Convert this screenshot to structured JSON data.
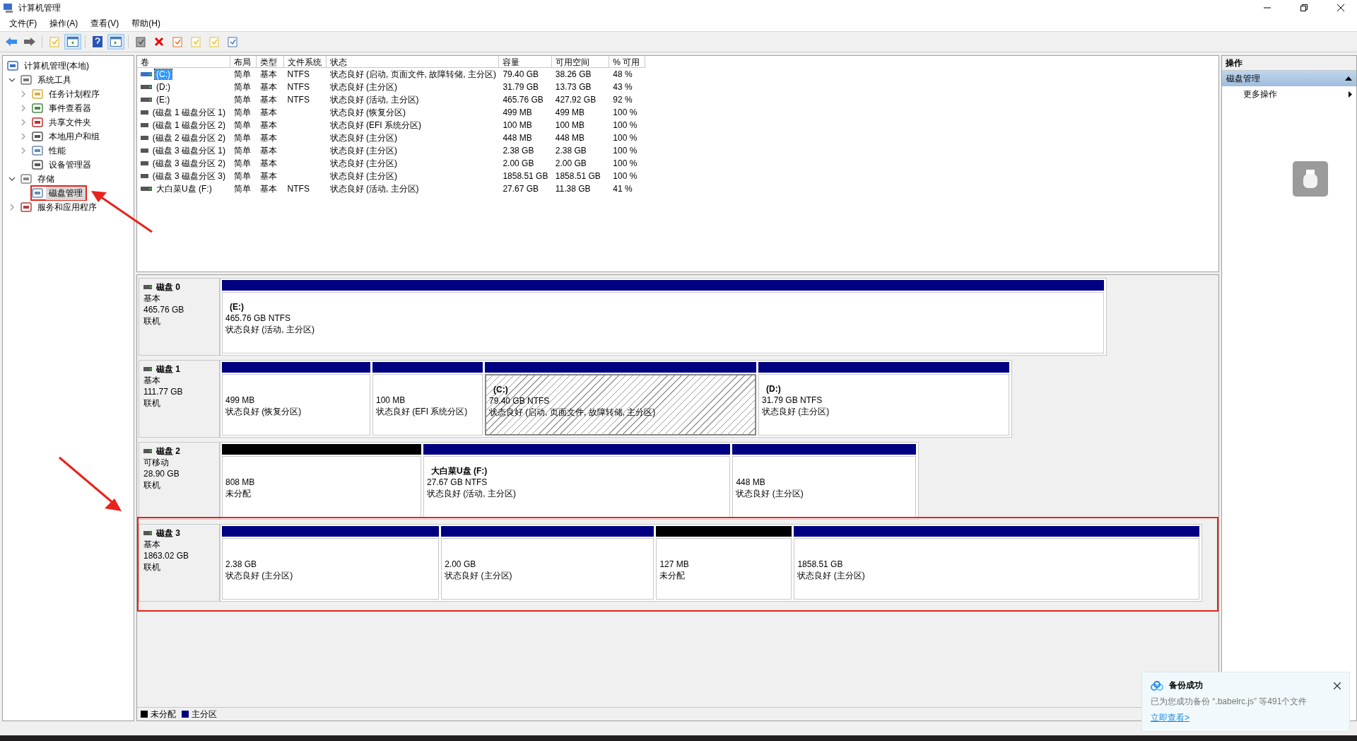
{
  "window": {
    "title": "计算机管理"
  },
  "menu": [
    "文件(F)",
    "操作(A)",
    "查看(V)",
    "帮助(H)"
  ],
  "toolbar": [
    {
      "pressed": false
    },
    {
      "pressed": false
    },
    {
      "pressed": false
    },
    {
      "pressed": true
    },
    {
      "pressed": false
    },
    {
      "pressed": true
    },
    {
      "pressed": false
    },
    {
      "pressed": false
    },
    {
      "pressed": false
    },
    {
      "pressed": false
    },
    {
      "pressed": false
    },
    {
      "pressed": false
    }
  ],
  "tree": [
    {
      "label": "计算机管理(本地)",
      "selected": false,
      "highlighted": false,
      "children": [
        {
          "label": "系统工具",
          "expanded": true,
          "selected": false,
          "highlighted": false,
          "children": [
            {
              "label": "任务计划程序",
              "expanded": false,
              "selected": false,
              "highlighted": false
            },
            {
              "label": "事件查看器",
              "expanded": false,
              "selected": false,
              "highlighted": false
            },
            {
              "label": "共享文件夹",
              "expanded": false,
              "selected": false,
              "highlighted": false
            },
            {
              "label": "本地用户和组",
              "expanded": false,
              "selected": false,
              "highlighted": false
            },
            {
              "label": "性能",
              "expanded": false,
              "selected": false,
              "highlighted": false
            },
            {
              "label": "设备管理器",
              "selected": false,
              "highlighted": false
            }
          ]
        },
        {
          "label": "存储",
          "expanded": true,
          "selected": false,
          "highlighted": false,
          "children": [
            {
              "label": "磁盘管理",
              "selected": true,
              "highlighted": true
            }
          ]
        },
        {
          "label": "服务和应用程序",
          "expanded": false,
          "selected": false,
          "highlighted": false
        }
      ]
    }
  ],
  "table": {
    "columns": [
      "卷",
      "布局",
      "类型",
      "文件系统",
      "状态",
      "容量",
      "可用空间",
      "% 可用"
    ],
    "rows": [
      {
        "selected": true,
        "cells": [
          "(C:)",
          "简单",
          "基本",
          "NTFS",
          "状态良好 (启动, 页面文件, 故障转储, 主分区)",
          "79.40 GB",
          "38.26 GB",
          "48 %"
        ]
      },
      {
        "selected": false,
        "cells": [
          "(D:)",
          "简单",
          "基本",
          "NTFS",
          "状态良好 (主分区)",
          "31.79 GB",
          "13.73 GB",
          "43 %"
        ]
      },
      {
        "selected": false,
        "cells": [
          "(E:)",
          "简单",
          "基本",
          "NTFS",
          "状态良好 (活动, 主分区)",
          "465.76 GB",
          "427.92 GB",
          "92 %"
        ]
      },
      {
        "selected": false,
        "cells": [
          "(磁盘 1 磁盘分区 1)",
          "简单",
          "基本",
          "",
          "状态良好 (恢复分区)",
          "499 MB",
          "499 MB",
          "100 %"
        ]
      },
      {
        "selected": false,
        "cells": [
          "(磁盘 1 磁盘分区 2)",
          "简单",
          "基本",
          "",
          "状态良好 (EFI 系统分区)",
          "100 MB",
          "100 MB",
          "100 %"
        ]
      },
      {
        "selected": false,
        "cells": [
          "(磁盘 2 磁盘分区 2)",
          "简单",
          "基本",
          "",
          "状态良好 (主分区)",
          "448 MB",
          "448 MB",
          "100 %"
        ]
      },
      {
        "selected": false,
        "cells": [
          "(磁盘 3 磁盘分区 1)",
          "简单",
          "基本",
          "",
          "状态良好 (主分区)",
          "2.38 GB",
          "2.38 GB",
          "100 %"
        ]
      },
      {
        "selected": false,
        "cells": [
          "(磁盘 3 磁盘分区 2)",
          "简单",
          "基本",
          "",
          "状态良好 (主分区)",
          "2.00 GB",
          "2.00 GB",
          "100 %"
        ]
      },
      {
        "selected": false,
        "cells": [
          "(磁盘 3 磁盘分区 3)",
          "简单",
          "基本",
          "",
          "状态良好 (主分区)",
          "1858.51 GB",
          "1858.51 GB",
          "100 %"
        ]
      },
      {
        "selected": false,
        "cells": [
          "大白菜U盘 (F:)",
          "简单",
          "基本",
          "NTFS",
          "状态良好 (活动, 主分区)",
          "27.67 GB",
          "11.38 GB",
          "41 %"
        ]
      }
    ]
  },
  "disks": [
    {
      "name": "磁盘 0",
      "type": "基本",
      "size": "465.76 GB",
      "state": "联机",
      "highlighted": false,
      "partitions": [
        {
          "kind": "primary",
          "selected": false,
          "name": "(E:)",
          "size": "465.76 GB NTFS",
          "status": "状态良好 (活动, 主分区)"
        }
      ]
    },
    {
      "name": "磁盘 1",
      "type": "基本",
      "size": "111.77 GB",
      "state": "联机",
      "highlighted": false,
      "partitions": [
        {
          "kind": "primary",
          "selected": false,
          "size": "499 MB",
          "status": "状态良好 (恢复分区)"
        },
        {
          "kind": "primary",
          "selected": false,
          "size": "100 MB",
          "status": "状态良好 (EFI 系统分区)"
        },
        {
          "kind": "primary",
          "selected": true,
          "name": "(C:)",
          "size": "79.40 GB NTFS",
          "status": "状态良好 (启动, 页面文件, 故障转储, 主分区)"
        },
        {
          "kind": "primary",
          "selected": false,
          "name": "(D:)",
          "size": "31.79 GB NTFS",
          "status": "状态良好 (主分区)"
        }
      ]
    },
    {
      "name": "磁盘 2",
      "type": "可移动",
      "size": "28.90 GB",
      "state": "联机",
      "highlighted": false,
      "partitions": [
        {
          "kind": "unallocated",
          "selected": false,
          "size": "808 MB",
          "status": "未分配"
        },
        {
          "kind": "primary",
          "selected": false,
          "name": "大白菜U盘  (F:)",
          "size": "27.67 GB NTFS",
          "status": "状态良好 (活动, 主分区)"
        },
        {
          "kind": "primary",
          "selected": false,
          "size": "448 MB",
          "status": "状态良好 (主分区)"
        }
      ]
    },
    {
      "name": "磁盘 3",
      "type": "基本",
      "size": "1863.02 GB",
      "state": "联机",
      "highlighted": true,
      "partitions": [
        {
          "kind": "primary",
          "selected": false,
          "size": "2.38 GB",
          "status": "状态良好 (主分区)"
        },
        {
          "kind": "primary",
          "selected": false,
          "size": "2.00 GB",
          "status": "状态良好 (主分区)"
        },
        {
          "kind": "unallocated",
          "selected": false,
          "size": "127 MB",
          "status": "未分配"
        },
        {
          "kind": "primary",
          "selected": false,
          "size": "1858.51 GB",
          "status": "状态良好 (主分区)"
        }
      ]
    }
  ],
  "legend": [
    {
      "kind": "unallocated",
      "label": "未分配"
    },
    {
      "kind": "primary",
      "label": "主分区"
    }
  ],
  "actions": {
    "title": "操作",
    "section": "磁盘管理",
    "expanded": true,
    "items": [
      "更多操作"
    ]
  },
  "notification": {
    "title": "备份成功",
    "text": "已为您成功备份 “.babelrc.js” 等491个文件",
    "link": "立即查看>"
  }
}
